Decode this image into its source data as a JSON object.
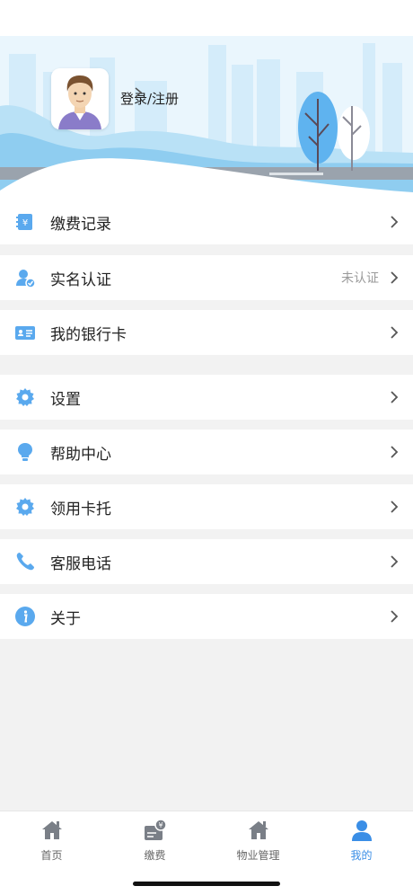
{
  "header": {
    "login_label": "登录/注册"
  },
  "menu": {
    "items": [
      {
        "label": "缴费记录",
        "icon": "payment-record-icon"
      },
      {
        "label": "实名认证",
        "icon": "verify-user-icon",
        "status": "未认证"
      },
      {
        "label": "我的银行卡",
        "icon": "bank-card-icon"
      },
      {
        "label": "设置",
        "icon": "gear-icon"
      },
      {
        "label": "帮助中心",
        "icon": "lightbulb-icon"
      },
      {
        "label": "领用卡托",
        "icon": "gear-icon"
      },
      {
        "label": "客服电话",
        "icon": "phone-icon"
      },
      {
        "label": "关于",
        "icon": "info-icon"
      }
    ]
  },
  "tabbar": {
    "tabs": [
      {
        "label": "首页",
        "icon": "home-icon"
      },
      {
        "label": "缴费",
        "icon": "bill-icon"
      },
      {
        "label": "物业管理",
        "icon": "property-icon"
      },
      {
        "label": "我的",
        "icon": "user-icon",
        "active": true
      }
    ]
  },
  "colors": {
    "accent": "#3a8ee6",
    "icon_blue": "#5aa9ee",
    "banner_sky": "#cfe9f8"
  }
}
